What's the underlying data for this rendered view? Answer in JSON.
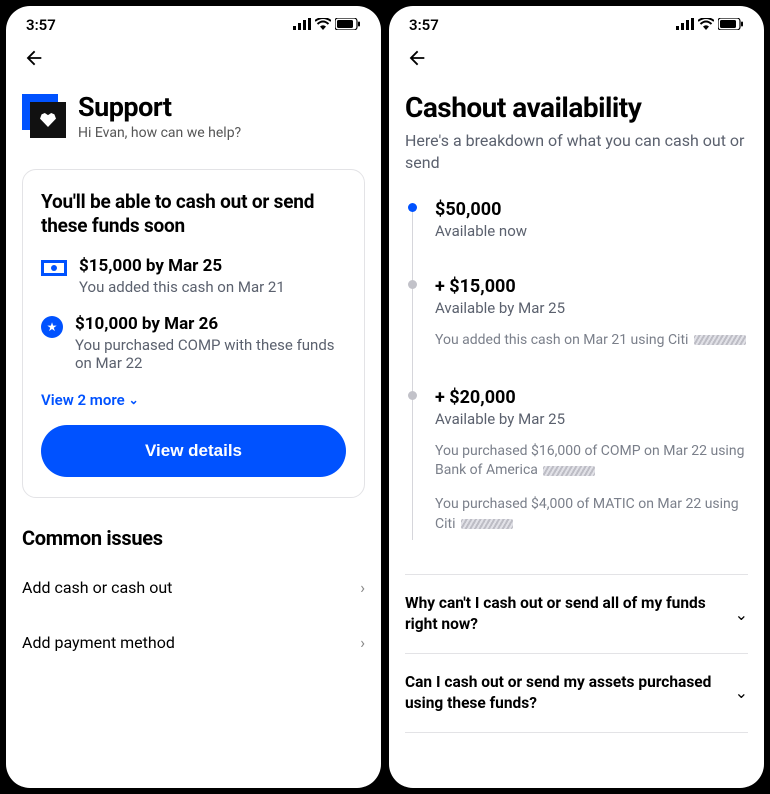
{
  "status": {
    "time": "3:57"
  },
  "left": {
    "support": {
      "title": "Support",
      "greeting": "Hi Evan, how can we help?"
    },
    "card": {
      "title": "You'll be able to cash out or send these funds soon",
      "items": [
        {
          "icon": "cash",
          "headline": "$15,000 by Mar 25",
          "sub": "You added this cash on Mar 21"
        },
        {
          "icon": "star",
          "headline": "$10,000 by Mar 26",
          "sub": "You purchased COMP with these funds on Mar 22"
        }
      ],
      "view_more": "View 2 more",
      "cta": "View details"
    },
    "common": {
      "heading": "Common issues",
      "rows": [
        "Add cash or cash out",
        "Add payment method"
      ]
    }
  },
  "right": {
    "title": "Cashout availability",
    "subtitle": "Here's a breakdown of what you can cash out or send",
    "timeline": [
      {
        "dot": "blue",
        "amount": "$50,000",
        "sub": "Available now",
        "notes": []
      },
      {
        "dot": "grey",
        "amount": "+ $15,000",
        "sub": "Available by Mar 25",
        "notes": [
          "You added this cash on Mar 21 using Citi"
        ],
        "redact_after_note": true
      },
      {
        "dot": "grey",
        "amount": "+ $20,000",
        "sub": "Available by Mar 25",
        "notes": [
          "You purchased $16,000 of COMP on Mar 22  using Bank of America",
          "You purchased $4,000 of MATIC on Mar 22 using Citi"
        ],
        "redact_after_note": true
      }
    ],
    "faqs": [
      "Why can't I cash out or send all of my funds right now?",
      "Can I cash out or send my assets purchased using these funds?"
    ]
  }
}
